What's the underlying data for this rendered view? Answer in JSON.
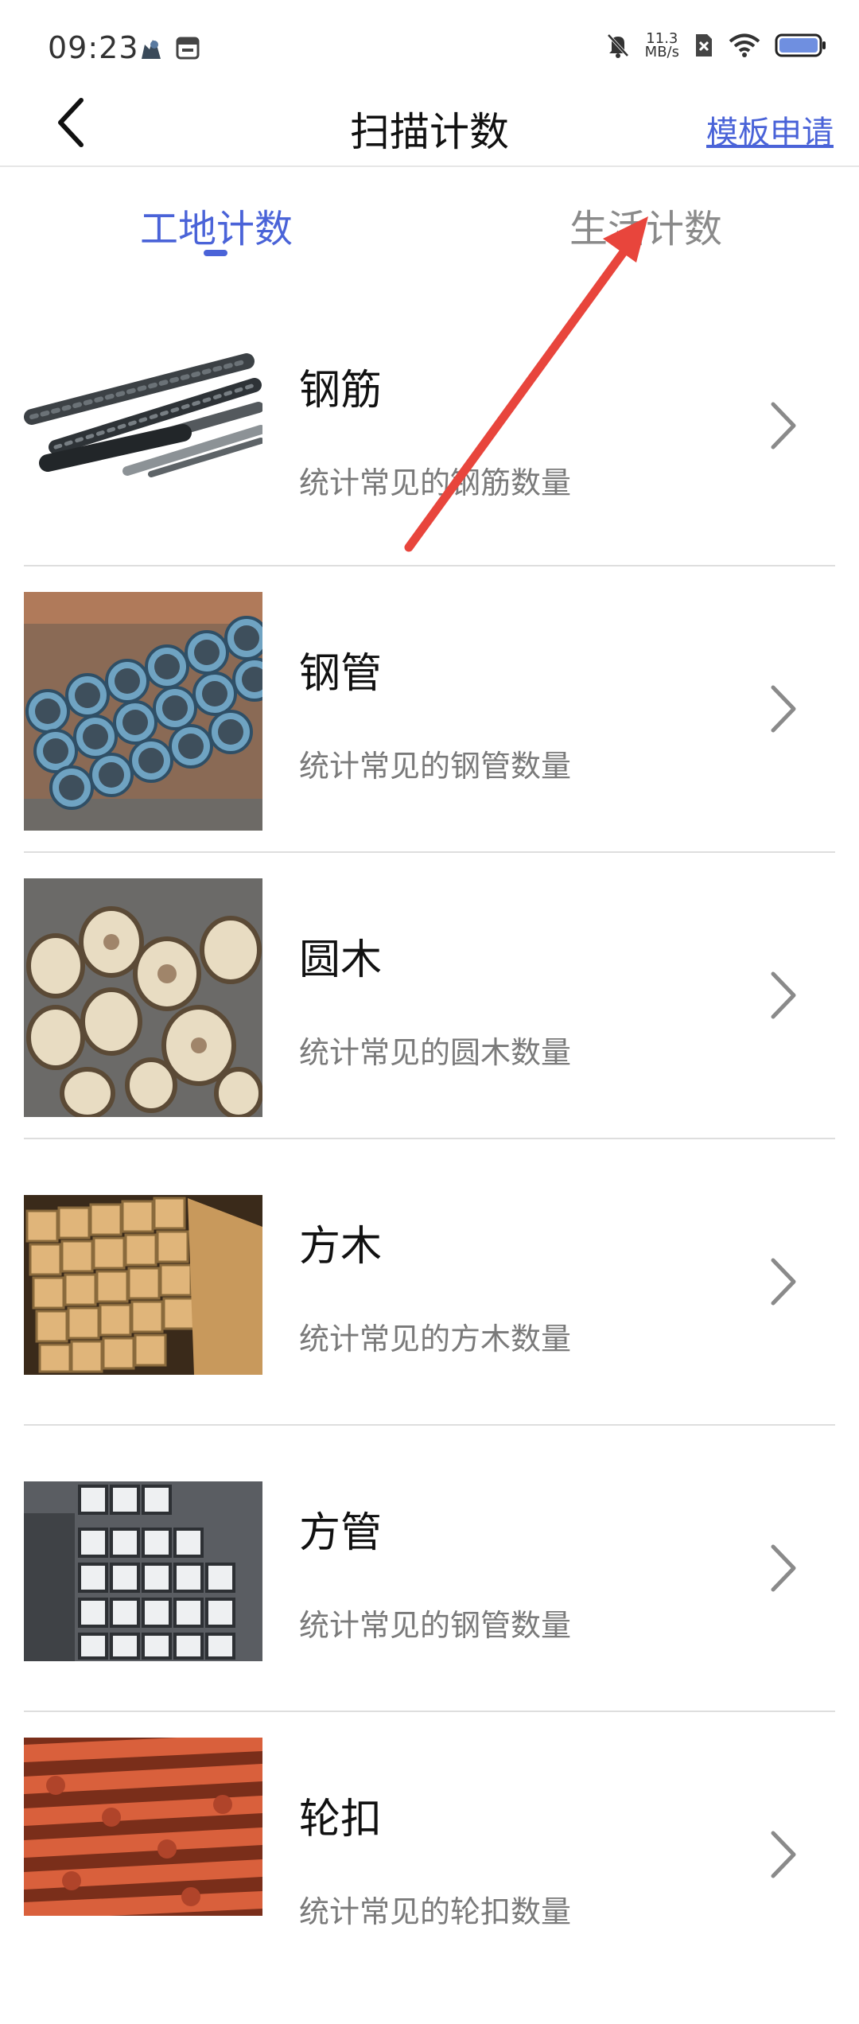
{
  "status_bar": {
    "time": "09:23",
    "speed_value": "11.3",
    "speed_unit": "MB/s"
  },
  "nav": {
    "title": "扫描计数",
    "template_link": "模板申请"
  },
  "tabs": [
    {
      "label": "工地计数",
      "active": true
    },
    {
      "label": "生活计数",
      "active": false
    }
  ],
  "items": [
    {
      "title": "钢筋",
      "desc": "统计常见的钢筋数量",
      "image": "rebar-image"
    },
    {
      "title": "钢管",
      "desc": "统计常见的钢管数量",
      "image": "steel-pipe-image"
    },
    {
      "title": "圆木",
      "desc": "统计常见的圆木数量",
      "image": "round-log-image"
    },
    {
      "title": "方木",
      "desc": "统计常见的方木数量",
      "image": "square-timber-image"
    },
    {
      "title": "方管",
      "desc": "统计常见的钢管数量",
      "image": "square-tube-image"
    },
    {
      "title": "轮扣",
      "desc": "统计常见的轮扣数量",
      "image": "wheel-buckle-image"
    }
  ],
  "colors": {
    "accent": "#4a63d8",
    "annotation": "#e8453c"
  }
}
